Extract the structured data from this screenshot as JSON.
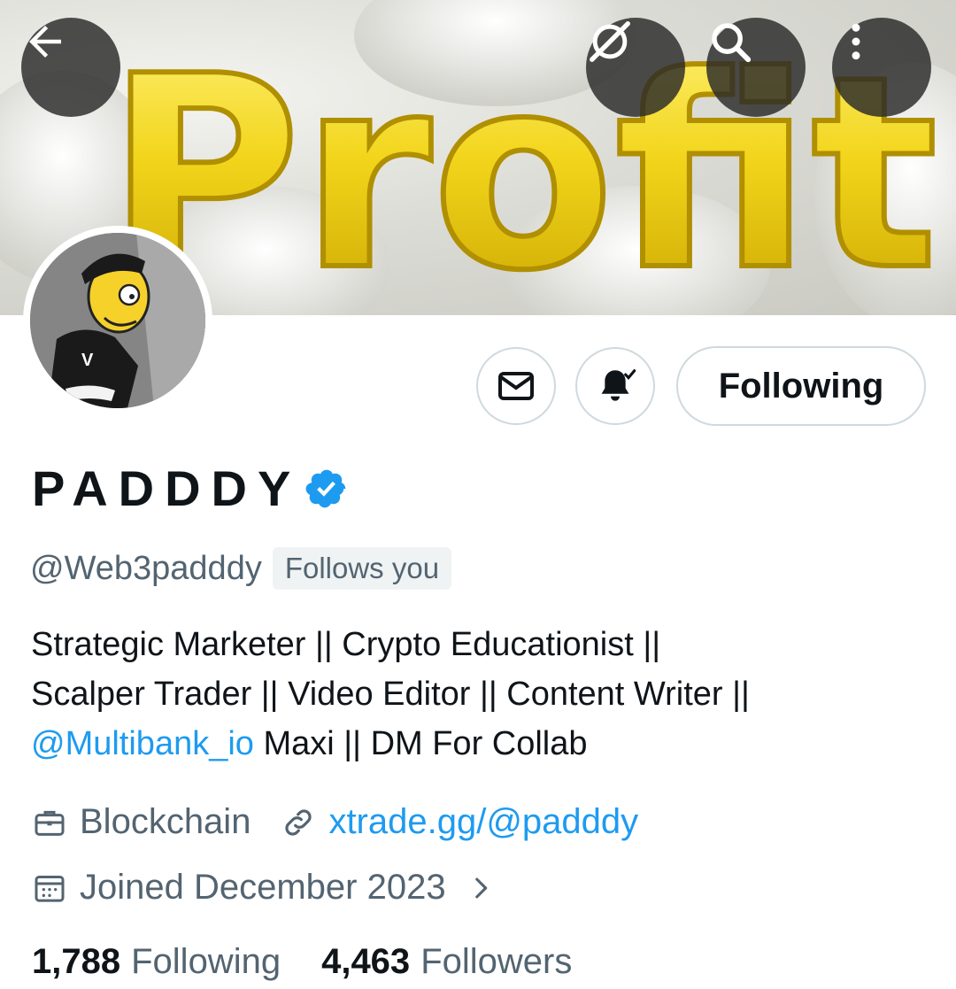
{
  "banner": {
    "art_text": "Profit"
  },
  "header": {
    "back_icon": "arrow-left-icon",
    "grok_icon": "grok-icon",
    "search_icon": "search-icon",
    "more_icon": "more-vertical-icon"
  },
  "actions": {
    "message_icon": "mail-icon",
    "notify_icon": "bell-check-icon",
    "follow_label": "Following"
  },
  "profile": {
    "display_name": "PADDDY",
    "handle": "@Web3padddy",
    "follows_you": "Follows you",
    "bio_1": "Strategic Marketer || Crypto Educationist ||",
    "bio_2": "Scalper Trader || Video Editor || Content Writer ||",
    "bio_mention": "@Multibank_io",
    "bio_3": " Maxi || DM For Collab",
    "category": "Blockchain",
    "website": "xtrade.gg/@padddy",
    "joined": "Joined December 2023"
  },
  "stats": {
    "following_count": "1,788",
    "following_label": "Following",
    "followers_count": "4,463",
    "followers_label": "Followers"
  },
  "colors": {
    "accent": "#1d9bf0",
    "secondary_text": "#536471",
    "banner_yellow": "#f2d51b"
  }
}
